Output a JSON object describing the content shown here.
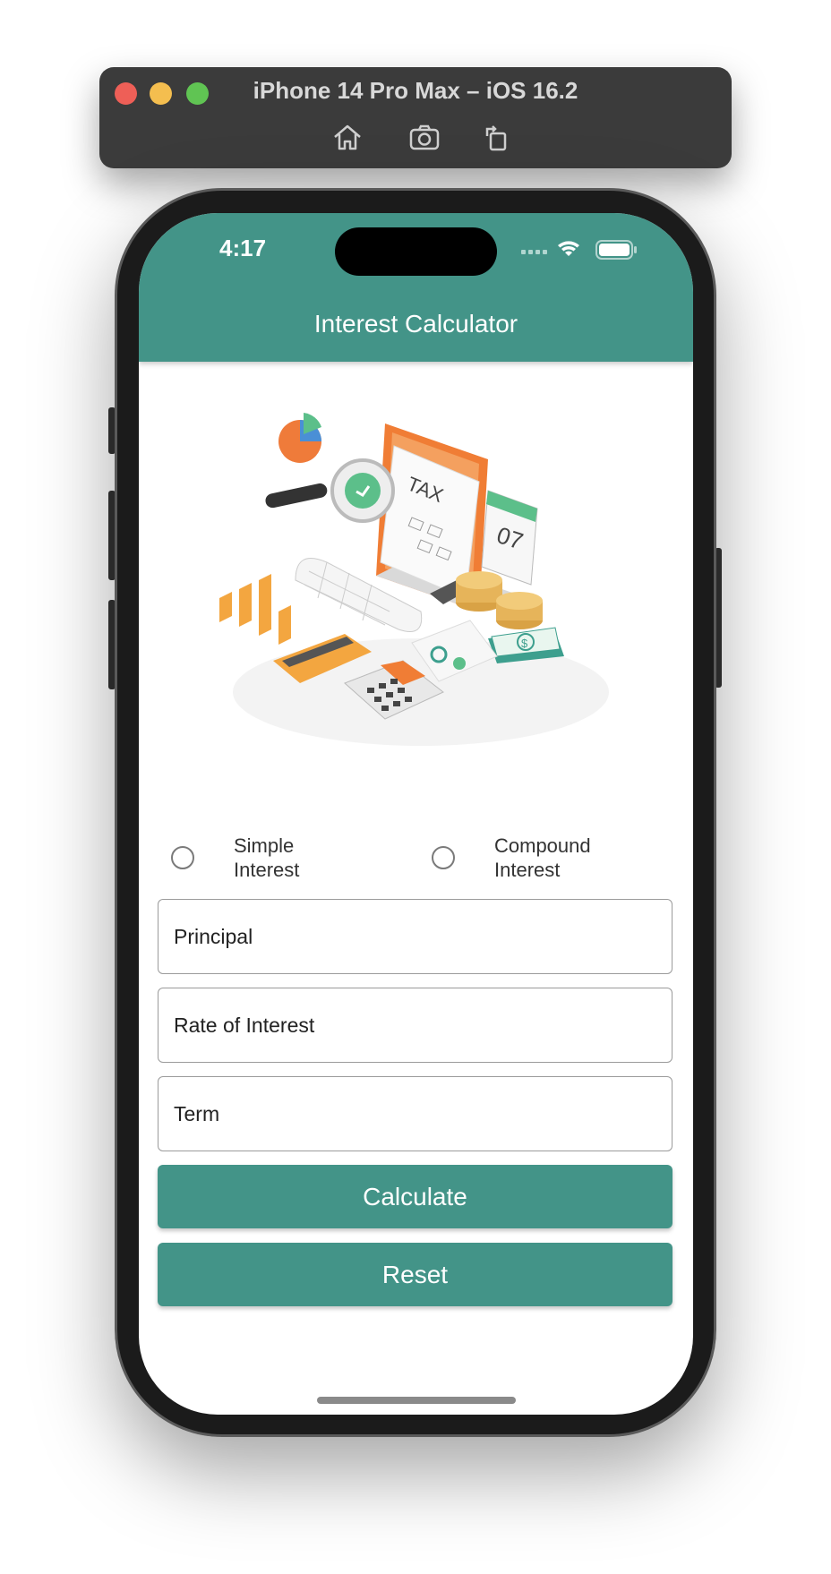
{
  "simulator": {
    "title": "iPhone 14 Pro Max – iOS 16.2",
    "tools": [
      "home-icon",
      "screenshot-icon",
      "rotate-icon"
    ]
  },
  "status_bar": {
    "time": "4:17",
    "icons": [
      "signal-icon",
      "wifi-icon",
      "battery-icon"
    ]
  },
  "app_bar": {
    "title": "Interest Calculator",
    "color": "#439488"
  },
  "illustration": {
    "label": "TAX",
    "calendar_day": "07",
    "currency_symbol": "$"
  },
  "interest_type": {
    "options": [
      {
        "label": "Simple Interest",
        "selected": false
      },
      {
        "label": "Compound Interest",
        "selected": false
      }
    ]
  },
  "form": {
    "principal_placeholder": "Principal",
    "rate_placeholder": "Rate of Interest",
    "term_placeholder": "Term",
    "calculate_label": "Calculate",
    "reset_label": "Reset"
  }
}
